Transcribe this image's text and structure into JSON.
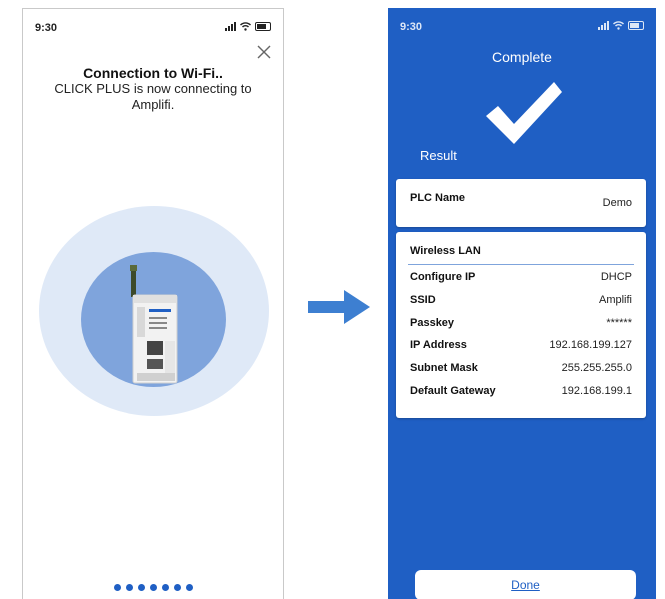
{
  "left_screen": {
    "status_time": "9:30",
    "title": "Connection to Wi-Fi..",
    "subtitle": "CLICK PLUS is now connecting to Amplifi.",
    "progress_dot_count": 7
  },
  "right_screen": {
    "status_time": "9:30",
    "header": "Complete",
    "result_label": "Result",
    "plc_name_label": "PLC Name",
    "plc_name_value": "Demo",
    "wlan_header": "Wireless LAN",
    "rows": [
      {
        "label": "Configure IP",
        "value": "DHCP"
      },
      {
        "label": "SSID",
        "value": "Amplifi"
      },
      {
        "label": "Passkey",
        "value": "******"
      },
      {
        "label": "IP Address",
        "value": "192.168.199.127"
      },
      {
        "label": "Subnet Mask",
        "value": "255.255.255.0"
      },
      {
        "label": "Default Gateway",
        "value": "192.168.199.1"
      }
    ],
    "done_label": "Done"
  },
  "colors": {
    "accent_blue": "#1f5fc4",
    "circle_light": "#dfe9f7",
    "circle_mid": "#7fa4dc",
    "arrow": "#3d7fd1"
  },
  "icons": [
    "close-icon",
    "wifi-icon",
    "signal-icon",
    "battery-icon",
    "checkmark-icon",
    "arrow-right-icon",
    "plc-device-illustration"
  ]
}
